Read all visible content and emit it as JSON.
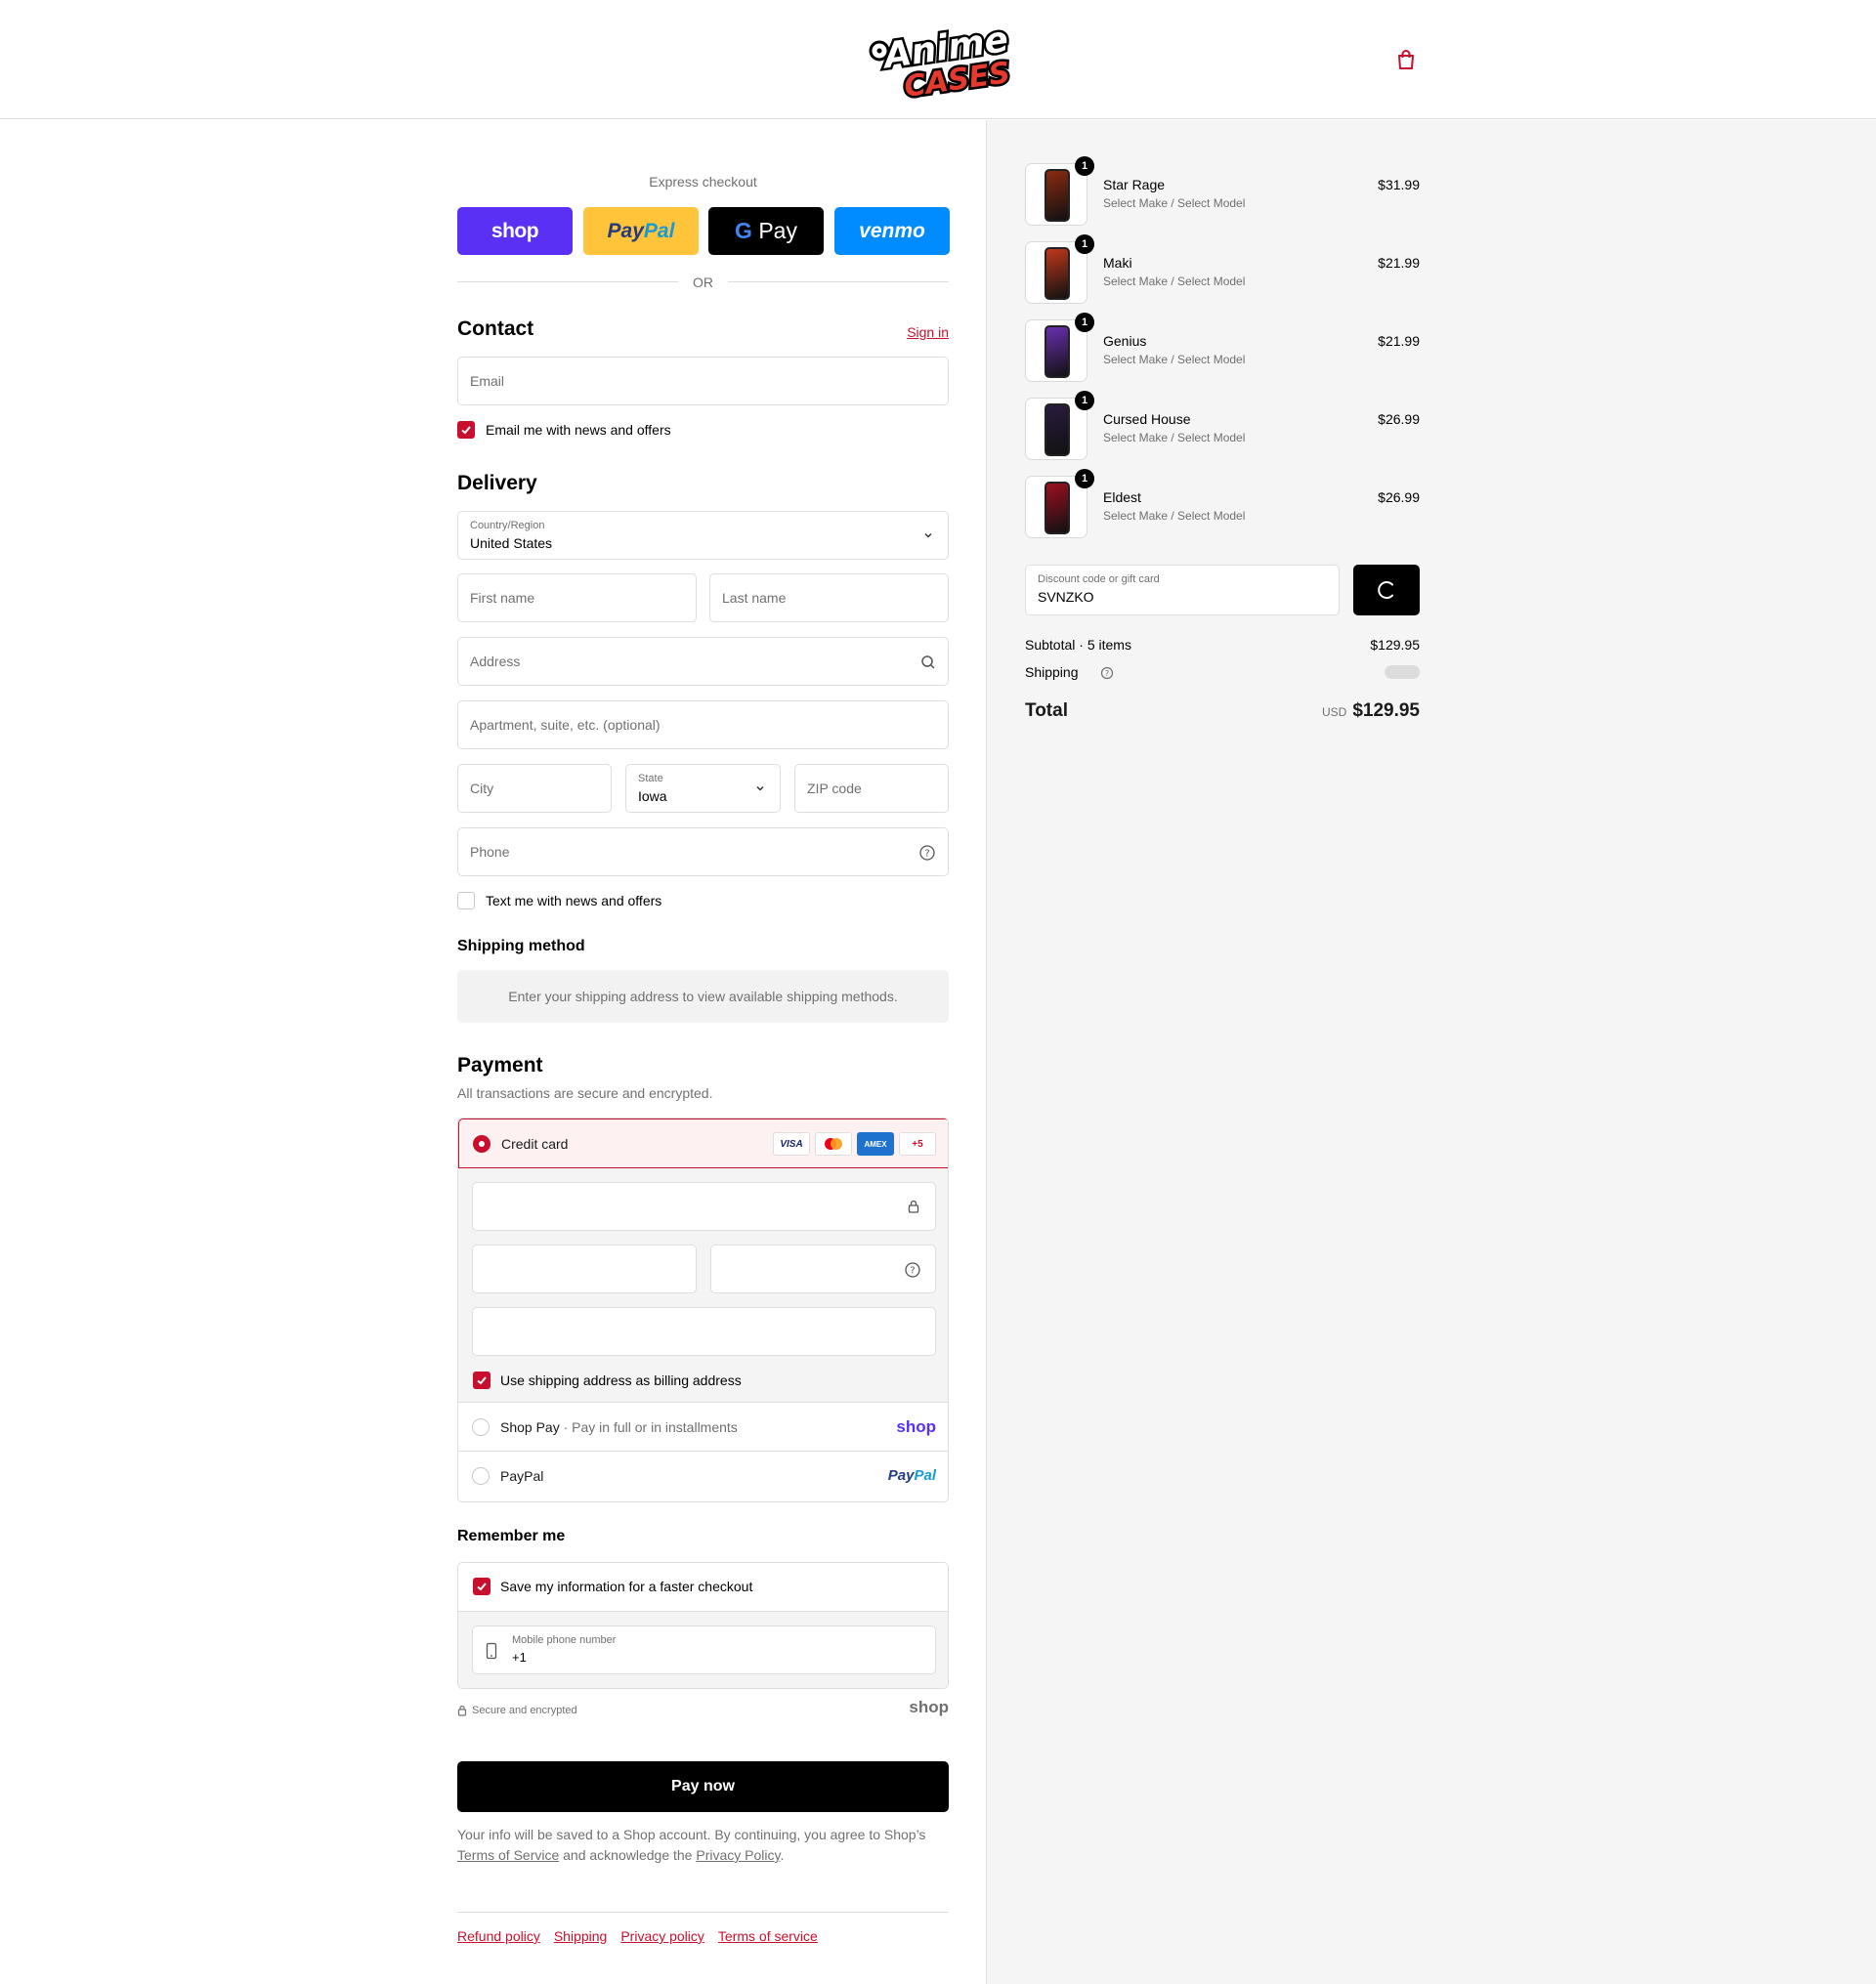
{
  "header": {
    "logo_line1": "Anime",
    "logo_line2": "CASES"
  },
  "express": {
    "label": "Express checkout",
    "shop": "shop",
    "paypal_a": "Pay",
    "paypal_b": "Pal",
    "gpay_g": "G",
    "gpay": "Pay",
    "venmo": "venmo",
    "or": "OR"
  },
  "contact": {
    "title": "Contact",
    "sign_in": "Sign in",
    "email_placeholder": "Email",
    "news_checkbox": "Email me with news and offers"
  },
  "delivery": {
    "title": "Delivery",
    "country_label": "Country/Region",
    "country_value": "United States",
    "first_name": "First name",
    "last_name": "Last name",
    "address": "Address",
    "apartment": "Apartment, suite, etc. (optional)",
    "city": "City",
    "state_label": "State",
    "state_value": "Iowa",
    "zip": "ZIP code",
    "phone": "Phone",
    "text_checkbox": "Text me with news and offers"
  },
  "shipping_method": {
    "title": "Shipping method",
    "info": "Enter your shipping address to view available shipping methods."
  },
  "payment": {
    "title": "Payment",
    "subtitle": "All transactions are secure and encrypted.",
    "credit_card": "Credit card",
    "badges": [
      "VISA",
      "",
      "AMEX",
      "+5"
    ],
    "billing_checkbox": "Use shipping address as billing address",
    "shop_pay": "Shop Pay",
    "shop_pay_sub": "Pay in full or in installments",
    "shop_logo": "shop",
    "paypal": "PayPal",
    "paypal_logo_a": "Pay",
    "paypal_logo_b": "Pal"
  },
  "remember": {
    "title": "Remember me",
    "save_checkbox": "Save my information for a faster checkout",
    "mobile_label": "Mobile phone number",
    "mobile_value": "+1",
    "secure": "Secure and encrypted",
    "shop_logo": "shop"
  },
  "pay_now": "Pay now",
  "legal": {
    "text1": "Your info will be saved to a Shop account. By continuing, you agree to Shop’s",
    "terms": "Terms of Service",
    "text2": "and acknowledge the",
    "privacy": "Privacy Policy",
    "text3": "."
  },
  "footer_links": [
    "Refund policy",
    "Shipping",
    "Privacy policy",
    "Terms of service"
  ],
  "cart_items": [
    {
      "name": "Star Rage",
      "variant": "Select Make / Select Model",
      "price": "$31.99",
      "qty": "1",
      "color": "#8a2a10"
    },
    {
      "name": "Maki",
      "variant": "Select Make / Select Model",
      "price": "$21.99",
      "qty": "1",
      "color": "#c0381c"
    },
    {
      "name": "Genius",
      "variant": "Select Make / Select Model",
      "price": "$21.99",
      "qty": "1",
      "color": "#6a2fb0"
    },
    {
      "name": "Cursed House",
      "variant": "Select Make / Select Model",
      "price": "$26.99",
      "qty": "1",
      "color": "#2a1b40"
    },
    {
      "name": "Eldest",
      "variant": "Select Make / Select Model",
      "price": "$26.99",
      "qty": "1",
      "color": "#9c1020"
    }
  ],
  "discount": {
    "label": "Discount code or gift card",
    "value": "SVNZKO"
  },
  "summary": {
    "subtotal_label": "Subtotal · 5 items",
    "subtotal": "$129.95",
    "shipping_label": "Shipping",
    "total_label": "Total",
    "currency": "USD",
    "total": "$129.95"
  },
  "colors": {
    "accent": "#c8102e",
    "shop": "#5a31f4",
    "paypal": "#ffc439",
    "venmo": "#008cff"
  }
}
